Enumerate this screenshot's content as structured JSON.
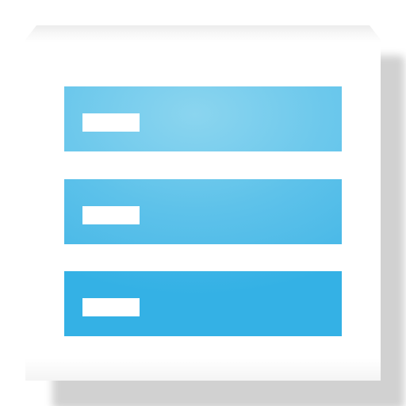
{
  "icon": {
    "name": "storage-list-icon",
    "rows": 3,
    "colors": {
      "card": "#ffffff",
      "bar_light": "#8bd5ef",
      "bar_dark": "#34b1e5",
      "tab": "#ffffff"
    }
  }
}
